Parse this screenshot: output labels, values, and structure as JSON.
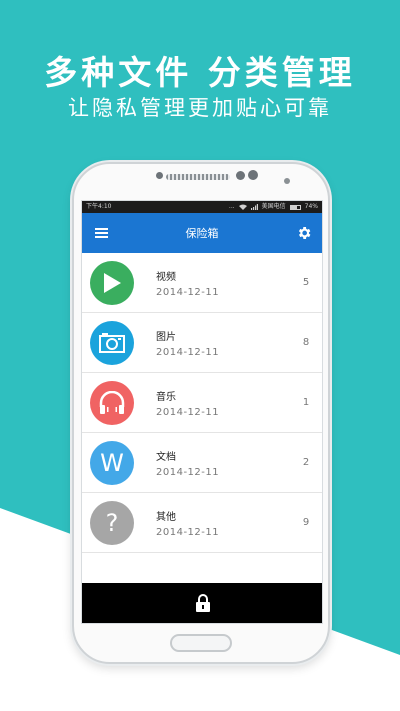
{
  "headline": "多种文件 分类管理",
  "subline": "让隐私管理更加贴心可靠",
  "status_bar": {
    "time": "下午4:10",
    "signal_text": "...",
    "carrier": "美国电信",
    "battery": "74%",
    "battery_level": 0.74
  },
  "app_bar": {
    "title": "保险箱"
  },
  "items": [
    {
      "name": "视频",
      "date": "2014-12-11",
      "count": "5",
      "icon": "play-icon",
      "color": "#3aae5f"
    },
    {
      "name": "图片",
      "date": "2014-12-11",
      "count": "8",
      "icon": "camera-icon",
      "color": "#1ba3dc"
    },
    {
      "name": "音乐",
      "date": "2014-12-11",
      "count": "1",
      "icon": "headphones-icon",
      "color": "#f06363"
    },
    {
      "name": "文档",
      "date": "2014-12-11",
      "count": "2",
      "icon": "document-w-icon",
      "letter": "W",
      "color": "#43a8e8"
    },
    {
      "name": "其他",
      "date": "2014-12-11",
      "count": "9",
      "icon": "question-icon",
      "letter": "?",
      "color": "#a6a6a6"
    }
  ],
  "colors": {
    "background": "#2fbfbf",
    "app_bar": "#1b76d2",
    "bottom_bar": "#000000"
  },
  "bottom_bar": {
    "icon": "lock-icon"
  }
}
